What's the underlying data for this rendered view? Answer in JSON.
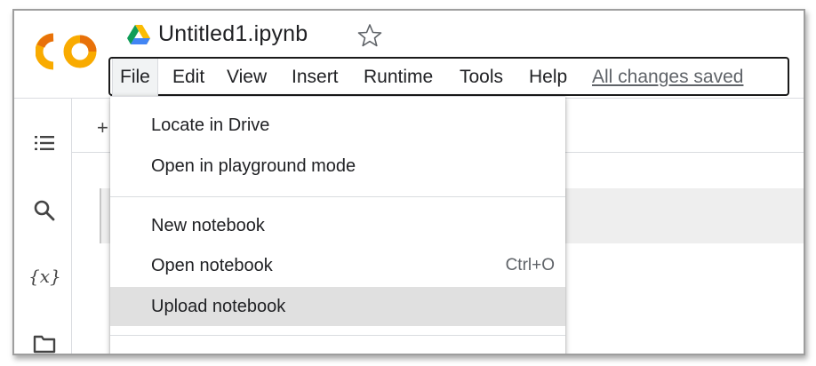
{
  "app": {
    "doc_title": "Untitled1.ipynb",
    "logo_text": "CO"
  },
  "menubar": {
    "items": [
      "File",
      "Edit",
      "View",
      "Insert",
      "Runtime",
      "Tools",
      "Help"
    ],
    "status_link": "All changes saved"
  },
  "sidebar": {
    "icons": [
      "table-of-contents-icon",
      "search-icon",
      "variables-icon",
      "folder-icon"
    ],
    "variables_glyph": "{x}"
  },
  "toolbar": {
    "add_glyph": "+"
  },
  "file_menu": {
    "groups": [
      [
        {
          "label": "Locate in Drive",
          "shortcut": ""
        },
        {
          "label": "Open in playground mode",
          "shortcut": ""
        }
      ],
      [
        {
          "label": "New notebook",
          "shortcut": ""
        },
        {
          "label": "Open notebook",
          "shortcut": "Ctrl+O"
        },
        {
          "label": "Upload notebook",
          "shortcut": ""
        }
      ]
    ],
    "highlighted": "Upload notebook"
  },
  "colors": {
    "logo_orange": "#F9AB00",
    "logo_dark_orange": "#E8710A",
    "menu_highlight": "#e0e0e0",
    "text": "#202124",
    "muted": "#5f6368"
  }
}
